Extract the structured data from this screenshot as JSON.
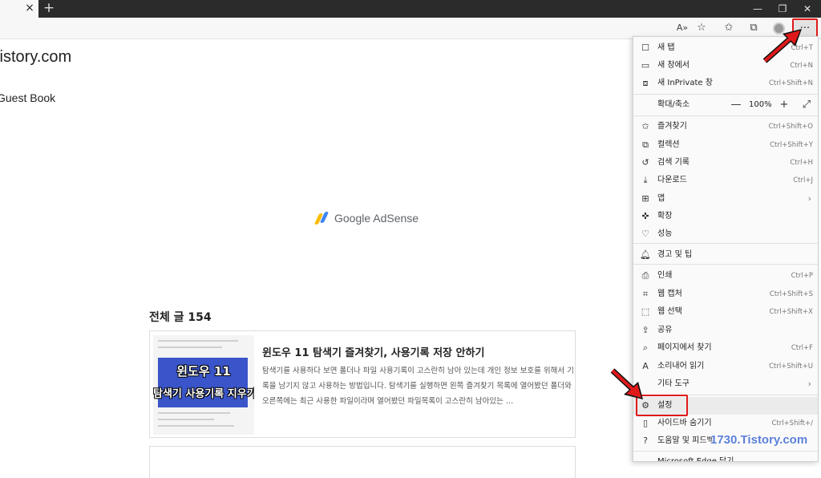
{
  "browser": {
    "tab_close": "×",
    "new_tab": "+",
    "window_controls": {
      "minimize": "—",
      "restore": "❐",
      "close": "✕"
    },
    "toolbar_icons": {
      "read_aloud": "A»",
      "favorite_add": "☆",
      "favorites": "✩",
      "collections": "⧉",
      "more": "···"
    }
  },
  "page": {
    "site_title": "tistory.com",
    "guest_book": "Guest Book",
    "adsense_label": "Google AdSense",
    "total_posts": "전체 글 154",
    "post": {
      "title": "윈도우 11 탐색기 즐겨찾기, 사용기록 저장 안하기",
      "excerpt": "탐색기를 사용하다 보면 폴더나 파일 사용기록이 고스란히 남아 있는데 개인 정보 보호를 위해서 기록을 남기지 않고 사용하는 방법입니다. 탐색기를 실행하면 왼쪽 즐겨찾기 목록에 열어봤던 폴더와 오른쪽에는 최근 사용한 파일이라며 열어봤던 파일목록이 고스란히 남아있는 …",
      "thumb_line1": "윈도우 11",
      "thumb_line2": "탐색기 사용기록 지우기"
    }
  },
  "menu": {
    "new_tab": {
      "label": "새 탭",
      "shortcut": "Ctrl+T",
      "icon": "new-tab-icon"
    },
    "new_window": {
      "label": "새 창에서",
      "shortcut": "Ctrl+N",
      "icon": "new-window-icon"
    },
    "inprivate": {
      "label": "새 InPrivate 창",
      "shortcut": "Ctrl+Shift+N",
      "icon": "inprivate-icon"
    },
    "zoom": {
      "label": "확대/축소",
      "value": "100%",
      "minus": "—",
      "plus": "+",
      "fullscreen": "⤢"
    },
    "favorites": {
      "label": "즐겨찾기",
      "shortcut": "Ctrl+Shift+O",
      "icon": "favorites-icon"
    },
    "collections": {
      "label": "컬렉션",
      "shortcut": "Ctrl+Shift+Y",
      "icon": "collections-icon"
    },
    "history": {
      "label": "검색 기록",
      "shortcut": "Ctrl+H",
      "icon": "history-icon"
    },
    "downloads": {
      "label": "다운로드",
      "shortcut": "Ctrl+J",
      "icon": "download-icon"
    },
    "apps": {
      "label": "앱",
      "arrow": "›",
      "icon": "apps-icon"
    },
    "extensions": {
      "label": "확장",
      "icon": "extensions-icon"
    },
    "performance": {
      "label": "성능",
      "icon": "performance-icon"
    },
    "alerts": {
      "label": "경고 및 팁",
      "icon": "bell-icon"
    },
    "print": {
      "label": "인쇄",
      "shortcut": "Ctrl+P",
      "icon": "print-icon"
    },
    "web_capture": {
      "label": "웹 캡처",
      "shortcut": "Ctrl+Shift+S",
      "icon": "web-capture-icon"
    },
    "web_select": {
      "label": "웹 선택",
      "shortcut": "Ctrl+Shift+X",
      "icon": "web-select-icon"
    },
    "share": {
      "label": "공유",
      "icon": "share-icon"
    },
    "find": {
      "label": "페이지에서 찾기",
      "shortcut": "Ctrl+F",
      "icon": "find-icon"
    },
    "read_aloud": {
      "label": "소리내어 읽기",
      "shortcut": "Ctrl+Shift+U",
      "icon": "read-aloud-icon"
    },
    "more_tools": {
      "label": "기타 도구",
      "arrow": "›"
    },
    "settings": {
      "label": "설정",
      "icon": "gear-icon"
    },
    "hide_sidebar": {
      "label": "사이드바 숨기기",
      "shortcut": "Ctrl+Shift+/",
      "icon": "sidebar-icon"
    },
    "help": {
      "label": "도움말 및 피드백",
      "icon": "help-icon"
    },
    "close_edge": {
      "label": "Microsoft Edge 닫기"
    }
  },
  "watermark": "1730.Tistory.com",
  "colors": {
    "highlight_red": "#e01a1a",
    "watermark_blue": "#5b7fd9"
  }
}
